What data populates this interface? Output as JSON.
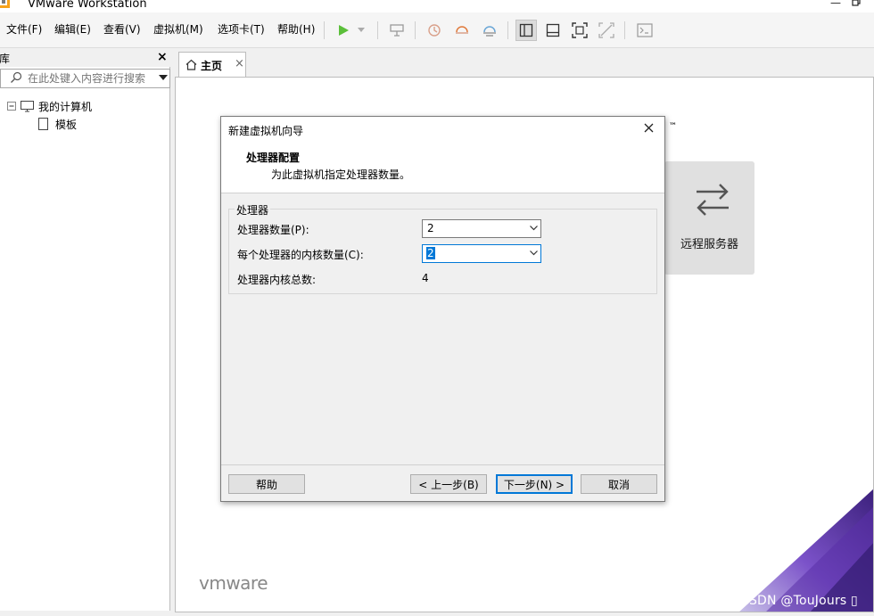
{
  "window": {
    "title": "VMware Workstation"
  },
  "menu": [
    "文件(F)",
    "编辑(E)",
    "查看(V)",
    "虚拟机(M)",
    "选项卡(T)",
    "帮助(H)"
  ],
  "library": {
    "title": "库",
    "search_placeholder": "在此处键入内容进行搜索",
    "tree": [
      "我的计算机",
      "模板"
    ]
  },
  "tab": {
    "label": "主页"
  },
  "home": {
    "remote_label": "远程服务器",
    "trademark": "™",
    "logo_text": "vmware",
    "watermark": "CSDN @TouJours ▯"
  },
  "dialog": {
    "title": "新建虚拟机向导",
    "header": "处理器配置",
    "subheader": "为此虚拟机指定处理器数量。",
    "group_label": "处理器",
    "fields": {
      "processors_label": "处理器数量(P):",
      "processors_value": "2",
      "cores_label": "每个处理器的内核数量(C):",
      "cores_value": "2",
      "total_label": "处理器内核总数:",
      "total_value": "4"
    },
    "buttons": {
      "help": "帮助",
      "back": "< 上一步(B)",
      "next": "下一步(N) >",
      "cancel": "取消"
    }
  },
  "colors": {
    "accent": "#0078d7",
    "play": "#5bbf3a"
  }
}
